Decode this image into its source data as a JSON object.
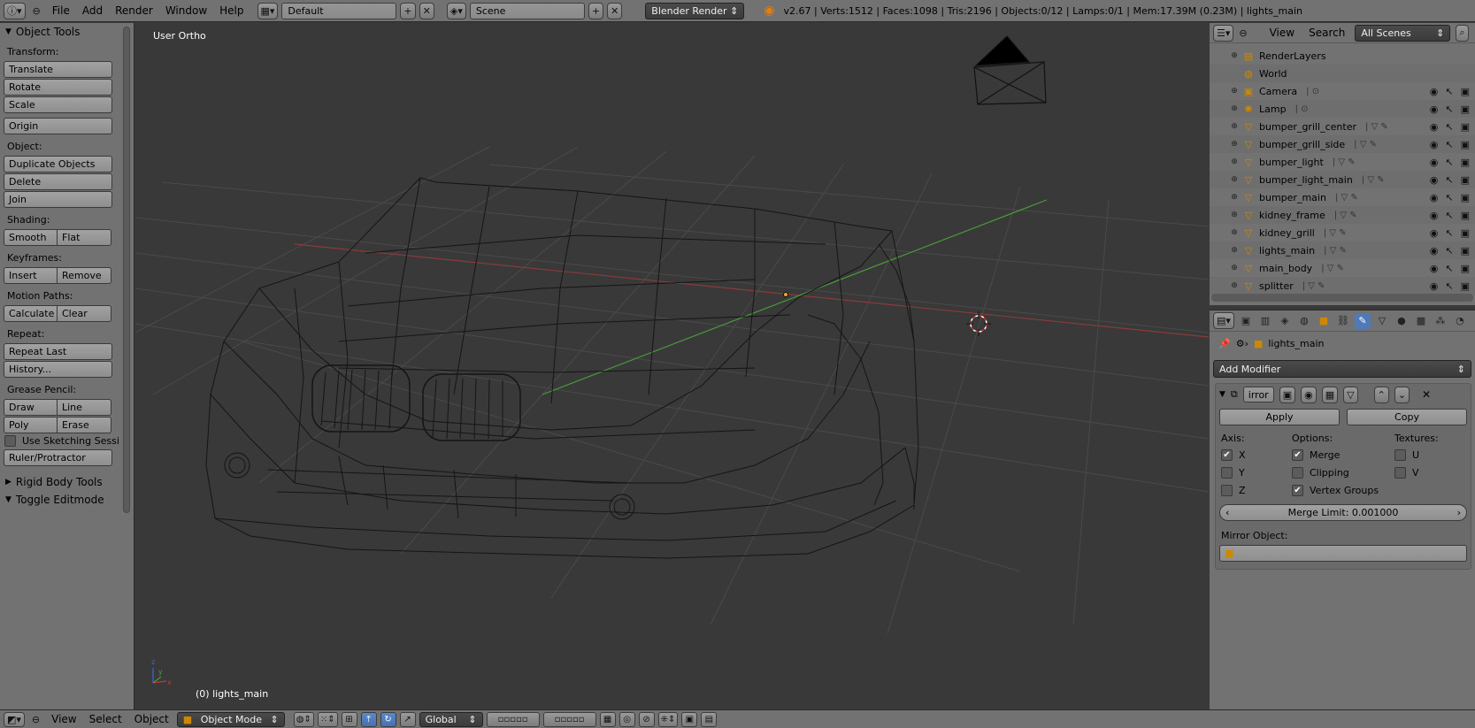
{
  "header": {
    "menus": [
      "File",
      "Add",
      "Render",
      "Window",
      "Help"
    ],
    "layout_name": "Default",
    "scene_name": "Scene",
    "render_engine": "Blender Render",
    "stats": "v2.67 | Verts:1512 | Faces:1098 | Tris:2196 | Objects:0/12 | Lamps:0/1 | Mem:17.39M (0.23M) | lights_main"
  },
  "toolshelf": {
    "title": "Object Tools",
    "transform_label": "Transform:",
    "translate": "Translate",
    "rotate": "Rotate",
    "scale": "Scale",
    "origin": "Origin",
    "object_label": "Object:",
    "duplicate": "Duplicate Objects",
    "delete": "Delete",
    "join": "Join",
    "shading_label": "Shading:",
    "smooth": "Smooth",
    "flat": "Flat",
    "keyframes_label": "Keyframes:",
    "insert": "Insert",
    "remove": "Remove",
    "motion_label": "Motion Paths:",
    "calculate": "Calculate",
    "clear": "Clear",
    "repeat_label": "Repeat:",
    "repeat_last": "Repeat Last",
    "history": "History...",
    "grease_label": "Grease Pencil:",
    "draw": "Draw",
    "line": "Line",
    "poly": "Poly",
    "erase": "Erase",
    "sketching": "Use Sketching Sessi",
    "ruler": "Ruler/Protractor",
    "rigid_body": "Rigid Body Tools",
    "toggle_edit": "Toggle Editmode"
  },
  "viewport": {
    "view_label": "User Ortho",
    "object_label": "(0) lights_main"
  },
  "outliner": {
    "view": "View",
    "search": "Search",
    "scope": "All Scenes",
    "items": [
      {
        "name": "RenderLayers",
        "icon": "renderlayers-icon",
        "glyph": "▤"
      },
      {
        "name": "World",
        "icon": "world-icon",
        "glyph": "◍"
      },
      {
        "name": "Camera",
        "icon": "camera-icon",
        "glyph": "▣"
      },
      {
        "name": "Lamp",
        "icon": "lamp-icon",
        "glyph": "✺"
      },
      {
        "name": "bumper_grill_center",
        "icon": "mesh-icon",
        "glyph": "▽"
      },
      {
        "name": "bumper_grill_side",
        "icon": "mesh-icon",
        "glyph": "▽"
      },
      {
        "name": "bumper_light",
        "icon": "mesh-icon",
        "glyph": "▽"
      },
      {
        "name": "bumper_light_main",
        "icon": "mesh-icon",
        "glyph": "▽"
      },
      {
        "name": "bumper_main",
        "icon": "mesh-icon",
        "glyph": "▽"
      },
      {
        "name": "kidney_frame",
        "icon": "mesh-icon",
        "glyph": "▽"
      },
      {
        "name": "kidney_grill",
        "icon": "mesh-icon",
        "glyph": "▽"
      },
      {
        "name": "lights_main",
        "icon": "mesh-icon",
        "glyph": "▽"
      },
      {
        "name": "main_body",
        "icon": "mesh-icon",
        "glyph": "▽"
      },
      {
        "name": "splitter",
        "icon": "mesh-icon",
        "glyph": "▽"
      }
    ]
  },
  "properties": {
    "object": "lights_main",
    "add_modifier": "Add Modifier",
    "modifier_name": "irror",
    "apply": "Apply",
    "copy": "Copy",
    "axis_label": "Axis:",
    "axis_x": "X",
    "axis_y": "Y",
    "axis_z": "Z",
    "axis_x_checked": true,
    "axis_y_checked": false,
    "axis_z_checked": false,
    "options_label": "Options:",
    "merge": "Merge",
    "merge_checked": true,
    "clipping": "Clipping",
    "clipping_checked": false,
    "vertex_groups": "Vertex Groups",
    "vertex_groups_checked": true,
    "textures_label": "Textures:",
    "tex_u": "U",
    "tex_v": "V",
    "tex_u_checked": false,
    "tex_v_checked": false,
    "merge_limit": "Merge Limit: 0.001000",
    "mirror_object_label": "Mirror Object:"
  },
  "bottombar": {
    "view": "View",
    "select": "Select",
    "object": "Object",
    "mode": "Object Mode",
    "orientation": "Global"
  }
}
